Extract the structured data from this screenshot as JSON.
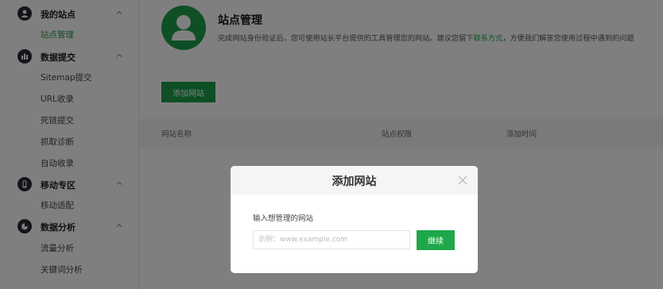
{
  "sidebar": {
    "sections": [
      {
        "label": "我的站点",
        "icon": "user-icon",
        "items": [
          "站点管理"
        ]
      },
      {
        "label": "数据提交",
        "icon": "bar-chart-icon",
        "items": [
          "Sitemap提交",
          "URL收录",
          "死链提交",
          "抓取诊断",
          "自动收录"
        ]
      },
      {
        "label": "移动专区",
        "icon": "mobile-icon",
        "items": [
          "移动适配"
        ]
      },
      {
        "label": "数据分析",
        "icon": "pie-chart-icon",
        "items": [
          "流量分析",
          "关键词分析"
        ]
      }
    ],
    "active_item": "站点管理"
  },
  "page": {
    "title": "站点管理",
    "subtitle_before": "完成网站身份验证后，您可使用站长平台提供的工具管理您的网站。建议您留下",
    "subtitle_link": "联系方式",
    "subtitle_after": "，方便我们解答您使用过程中遇到的问题",
    "add_button": "添加网站"
  },
  "table": {
    "headers": [
      "网站名称",
      "站点权限",
      "添加时间"
    ]
  },
  "modal": {
    "title": "添加网站",
    "label": "输入想管理的网站",
    "input_placeholder": "示例：www.example.com",
    "input_value": "",
    "continue_button": "继续"
  },
  "colors": {
    "brand_green": "#1ea048",
    "sidebar_icon": "#262b33",
    "overlay": "rgba(0,0,0,0.5)"
  }
}
